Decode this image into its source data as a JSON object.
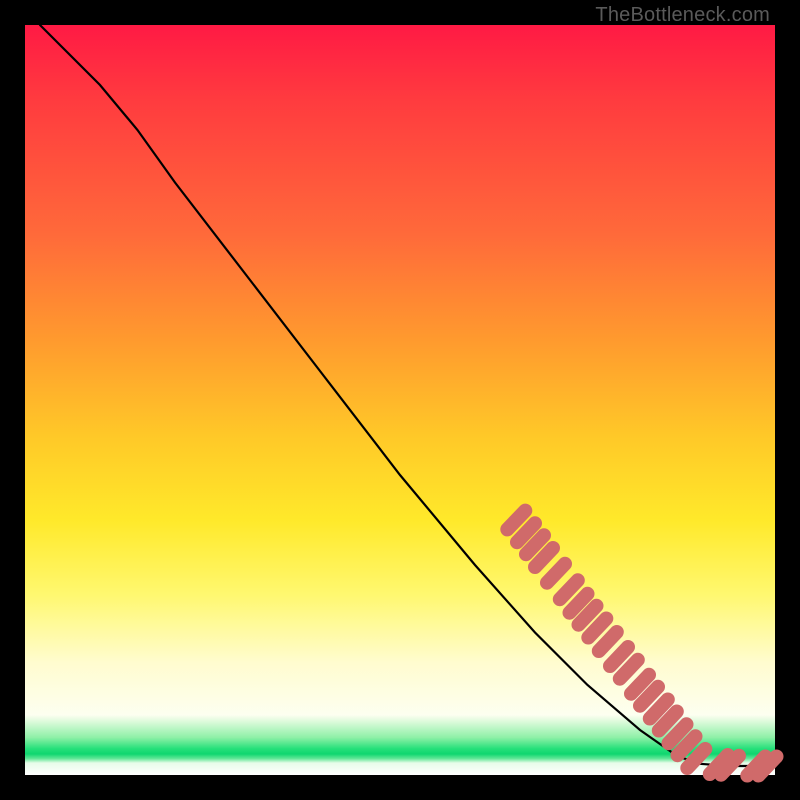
{
  "watermark": "TheBottleneck.com",
  "chart_data": {
    "type": "line",
    "title": "",
    "xlabel": "",
    "ylabel": "",
    "xlim": [
      0,
      100
    ],
    "ylim": [
      0,
      100
    ],
    "curve": [
      {
        "x": 2,
        "y": 100
      },
      {
        "x": 5,
        "y": 97
      },
      {
        "x": 10,
        "y": 92
      },
      {
        "x": 15,
        "y": 86
      },
      {
        "x": 20,
        "y": 79
      },
      {
        "x": 30,
        "y": 66
      },
      {
        "x": 40,
        "y": 53
      },
      {
        "x": 50,
        "y": 40
      },
      {
        "x": 60,
        "y": 28
      },
      {
        "x": 68,
        "y": 19
      },
      {
        "x": 75,
        "y": 12
      },
      {
        "x": 82,
        "y": 6
      },
      {
        "x": 87,
        "y": 2.5
      },
      {
        "x": 90,
        "y": 1.5
      },
      {
        "x": 94,
        "y": 1.2
      },
      {
        "x": 98,
        "y": 1.2
      }
    ],
    "points": [
      {
        "x": 65.5,
        "y": 34.0
      },
      {
        "x": 66.8,
        "y": 32.3
      },
      {
        "x": 68.0,
        "y": 30.7
      },
      {
        "x": 69.2,
        "y": 29.0
      },
      {
        "x": 70.8,
        "y": 26.9
      },
      {
        "x": 72.5,
        "y": 24.7
      },
      {
        "x": 73.8,
        "y": 22.9
      },
      {
        "x": 75.0,
        "y": 21.3
      },
      {
        "x": 76.3,
        "y": 19.6
      },
      {
        "x": 77.7,
        "y": 17.8
      },
      {
        "x": 79.2,
        "y": 15.8
      },
      {
        "x": 80.5,
        "y": 14.1
      },
      {
        "x": 82.0,
        "y": 12.1
      },
      {
        "x": 83.2,
        "y": 10.5
      },
      {
        "x": 84.5,
        "y": 8.8
      },
      {
        "x": 85.7,
        "y": 7.2
      },
      {
        "x": 87.0,
        "y": 5.5
      },
      {
        "x": 88.2,
        "y": 3.9
      },
      {
        "x": 89.5,
        "y": 2.2
      },
      {
        "x": 92.5,
        "y": 1.4
      },
      {
        "x": 94.0,
        "y": 1.3
      },
      {
        "x": 97.5,
        "y": 1.2
      },
      {
        "x": 99.0,
        "y": 1.2
      }
    ],
    "point_color": "#d06a6a",
    "curve_color": "#000000"
  }
}
